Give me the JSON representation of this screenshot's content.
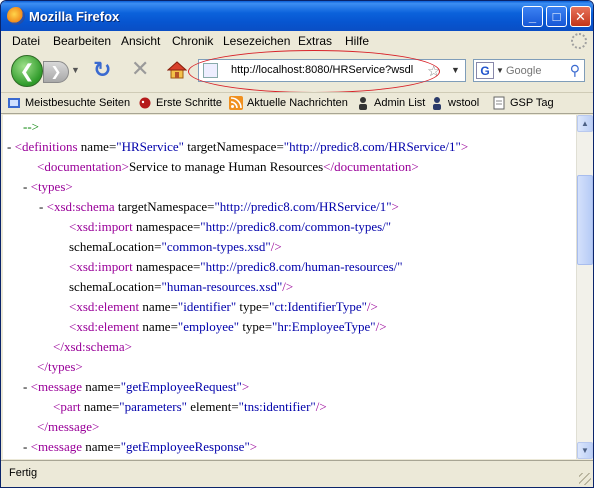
{
  "window": {
    "title": "Mozilla Firefox"
  },
  "title_buttons": {
    "minimize": "_",
    "maximize": "□",
    "close": "✕"
  },
  "menu": {
    "items": [
      "Datei",
      "Bearbeiten",
      "Ansicht",
      "Chronik",
      "Lesezeichen",
      "Extras",
      "Hilfe"
    ]
  },
  "navigation": {
    "back_glyph": "❮",
    "forward_glyph": "❯",
    "reload_glyph": "↻",
    "stop_glyph": "✕",
    "url": "http://localhost:8080/HRService?wsdl",
    "search_placeholder": "Google",
    "search_engine_letter": "G"
  },
  "bookmarks": {
    "items": [
      {
        "label": "Meistbesuchte Seiten",
        "icon": "bookmark-folder-icon"
      },
      {
        "label": "Erste Schritte",
        "icon": "firefox-bug-icon"
      },
      {
        "label": "Aktuelle Nachrichten",
        "icon": "rss-feed-icon"
      },
      {
        "label": "Admin List",
        "icon": "person-icon"
      },
      {
        "label": "wstool",
        "icon": "person-icon"
      },
      {
        "label": "GSP Tag",
        "icon": "page-icon"
      }
    ]
  },
  "xml": {
    "lines": [
      {
        "text": "-->",
        "kind": "comment"
      },
      {
        "prefix": "- ",
        "open": "<",
        "tag": "definitions",
        "attrs": [
          {
            "n": "name",
            "v": "HRService"
          },
          {
            "n": "targetNamespace",
            "v": "http://predic8.com/HRService/1"
          }
        ],
        "close": ">"
      },
      {
        "open": "<",
        "tag": "documentation",
        "close": ">",
        "text_content": "Service to manage Human Resources",
        "end": "</",
        "end_tag": "documentation",
        "end_close": ">"
      },
      {
        "prefix": "- ",
        "open": "<",
        "tag": "types",
        "close": ">"
      },
      {
        "prefix": "- ",
        "open": "<",
        "tag": "xsd:schema",
        "attrs": [
          {
            "n": "targetNamespace",
            "v": "http://predic8.com/HRService/1"
          }
        ],
        "close": ">"
      },
      {
        "open": "<",
        "tag": "xsd:import",
        "attrs": [
          {
            "n": "namespace",
            "v": "http://predic8.com/common-types/"
          }
        ],
        "close": ""
      },
      {
        "attrs": [
          {
            "n": "schemaLocation",
            "v": "common-types.xsd"
          }
        ],
        "close": "/>"
      },
      {
        "open": "<",
        "tag": "xsd:import",
        "attrs": [
          {
            "n": "namespace",
            "v": "http://predic8.com/human-resources/"
          }
        ],
        "close": ""
      },
      {
        "attrs": [
          {
            "n": "schemaLocation",
            "v": "human-resources.xsd"
          }
        ],
        "close": "/>"
      },
      {
        "open": "<",
        "tag": "xsd:element",
        "attrs": [
          {
            "n": "name",
            "v": "identifier"
          },
          {
            "n": "type",
            "v": "ct:IdentifierType"
          }
        ],
        "close": "/>"
      },
      {
        "open": "<",
        "tag": "xsd:element",
        "attrs": [
          {
            "n": "name",
            "v": "employee"
          },
          {
            "n": "type",
            "v": "hr:EmployeeType"
          }
        ],
        "close": "/>"
      },
      {
        "open": "</",
        "tag": "xsd:schema",
        "close": ">"
      },
      {
        "open": "</",
        "tag": "types",
        "close": ">"
      },
      {
        "prefix": "- ",
        "open": "<",
        "tag": "message",
        "attrs": [
          {
            "n": "name",
            "v": "getEmployeeRequest"
          }
        ],
        "close": ">"
      },
      {
        "open": "<",
        "tag": "part",
        "attrs": [
          {
            "n": "name",
            "v": "parameters"
          },
          {
            "n": "element",
            "v": "tns:identifier"
          }
        ],
        "close": "/>"
      },
      {
        "open": "</",
        "tag": "message",
        "close": ">"
      },
      {
        "prefix": "- ",
        "open": "<",
        "tag": "message",
        "attrs": [
          {
            "n": "name",
            "v": "getEmployeeResponse"
          }
        ],
        "close": ">"
      }
    ]
  },
  "status": {
    "text": "Fertig"
  },
  "colors": {
    "tag": "#990099",
    "value": "#0000aa",
    "comment": "#008000",
    "highlight_circle": "#d8232a"
  }
}
